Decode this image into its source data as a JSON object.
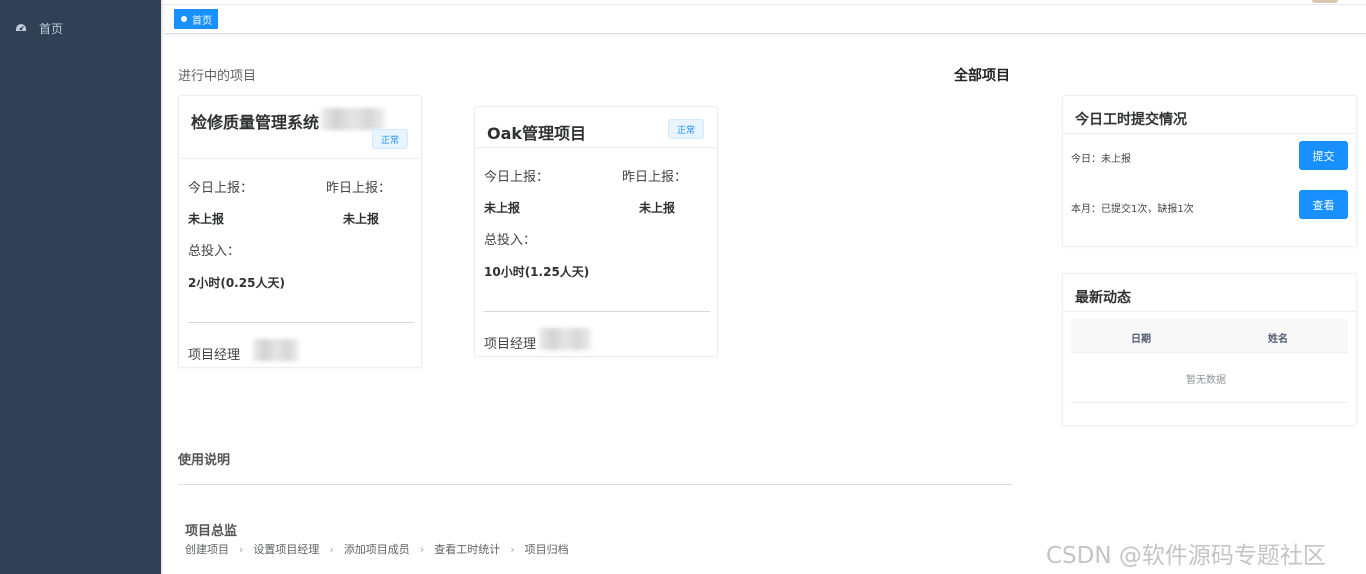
{
  "sidebar": {
    "items": [
      {
        "label": "首页",
        "icon": "dashboard-icon"
      }
    ]
  },
  "tags_view": {
    "active_tag": "首页"
  },
  "ongoing": {
    "title": "进行中的项目",
    "all_link": "全部项目"
  },
  "projects": [
    {
      "name": "检修质量管理系统",
      "status": "正常",
      "today_label": "今日上报：",
      "today_value": "未上报",
      "yesterday_label": "昨日上报：",
      "yesterday_value": "未上报",
      "total_label": "总投入：",
      "total_value": "2小时(0.25人天)",
      "manager_label": "项目经理"
    },
    {
      "name": "Oak管理项目",
      "status": "正常",
      "today_label": "今日上报：",
      "today_value": "未上报",
      "yesterday_label": "昨日上报：",
      "yesterday_value": "未上报",
      "total_label": "总投入：",
      "total_value": "10小时(1.25人天)",
      "manager_label": "项目经理"
    }
  ],
  "worktime": {
    "title": "今日工时提交情况",
    "today_text": "今日：未上报",
    "submit_btn": "提交",
    "month_text": "本月：已提交1次，缺报1次",
    "view_btn": "查看"
  },
  "news": {
    "title": "最新动态",
    "columns": [
      "日期",
      "姓名"
    ],
    "empty_text": "暂无数据"
  },
  "usage": {
    "title": "使用说明",
    "role": "项目总监",
    "steps": [
      "创建项目",
      "设置项目经理",
      "添加项目成员",
      "查看工时统计",
      "项目归档"
    ]
  },
  "watermark": "CSDN @软件源码专题社区",
  "colors": {
    "sidebar_bg": "#304156",
    "primary": "#1890ff"
  }
}
